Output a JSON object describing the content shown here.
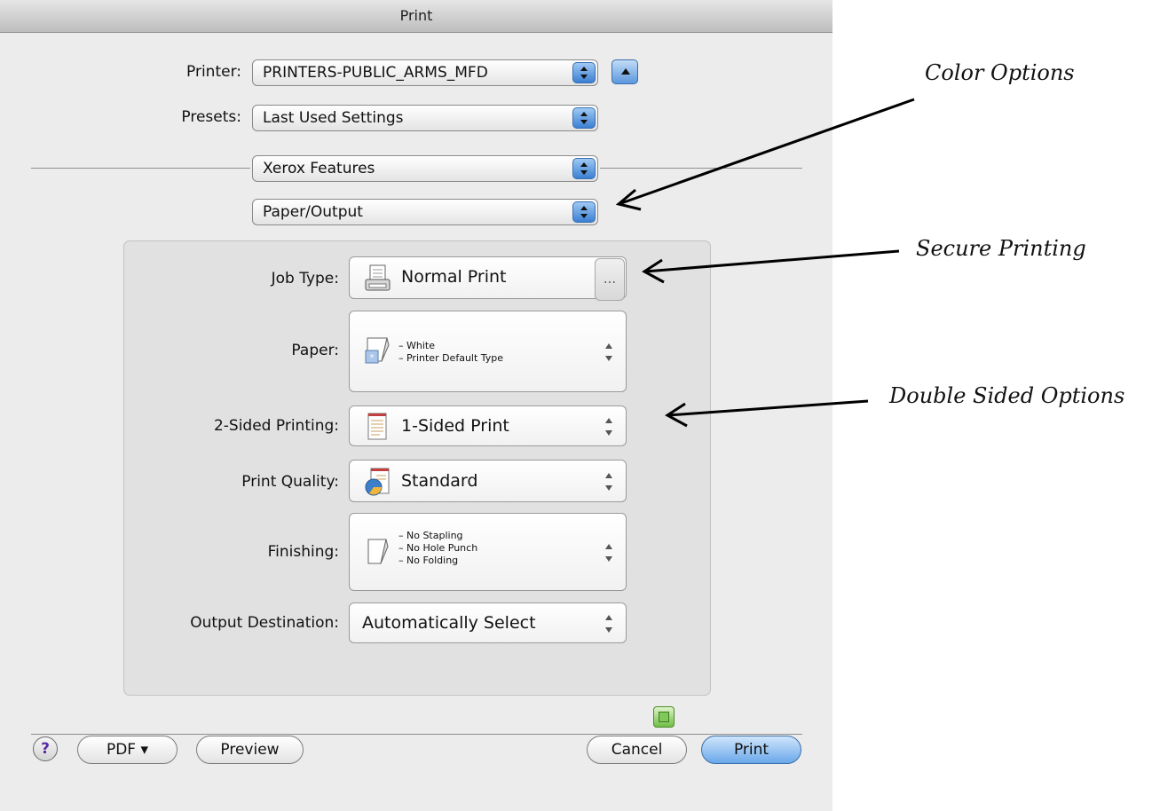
{
  "window": {
    "title": "Print"
  },
  "printer": {
    "label": "Printer:",
    "value": "PRINTERS-PUBLIC_ARMS_MFD"
  },
  "presets": {
    "label": "Presets:",
    "value": "Last Used Settings"
  },
  "features_menu": {
    "value": "Xerox Features"
  },
  "section_menu": {
    "value": "Paper/Output"
  },
  "panel": {
    "job_type": {
      "label": "Job Type:",
      "value": "Normal Print",
      "more": "..."
    },
    "paper": {
      "label": "Paper:",
      "lines": [
        "– White",
        "– Printer Default Type"
      ]
    },
    "two_sided": {
      "label": "2-Sided Printing:",
      "value": "1-Sided Print"
    },
    "print_quality": {
      "label": "Print Quality:",
      "value": "Standard"
    },
    "finishing": {
      "label": "Finishing:",
      "lines": [
        "– No Stapling",
        "– No Hole Punch",
        "– No Folding"
      ]
    },
    "output_destination": {
      "label": "Output Destination:",
      "value": "Automatically Select"
    }
  },
  "buttons": {
    "help": "?",
    "pdf": "PDF ▾",
    "preview": "Preview",
    "cancel": "Cancel",
    "print": "Print"
  },
  "annotations": {
    "color": "Color Options",
    "secure": "Secure Printing",
    "double": "Double Sided Options"
  },
  "colors": {
    "accent": "#5b97dd",
    "dialog_bg": "#ececec",
    "panel_bg": "#e1e1e1"
  }
}
